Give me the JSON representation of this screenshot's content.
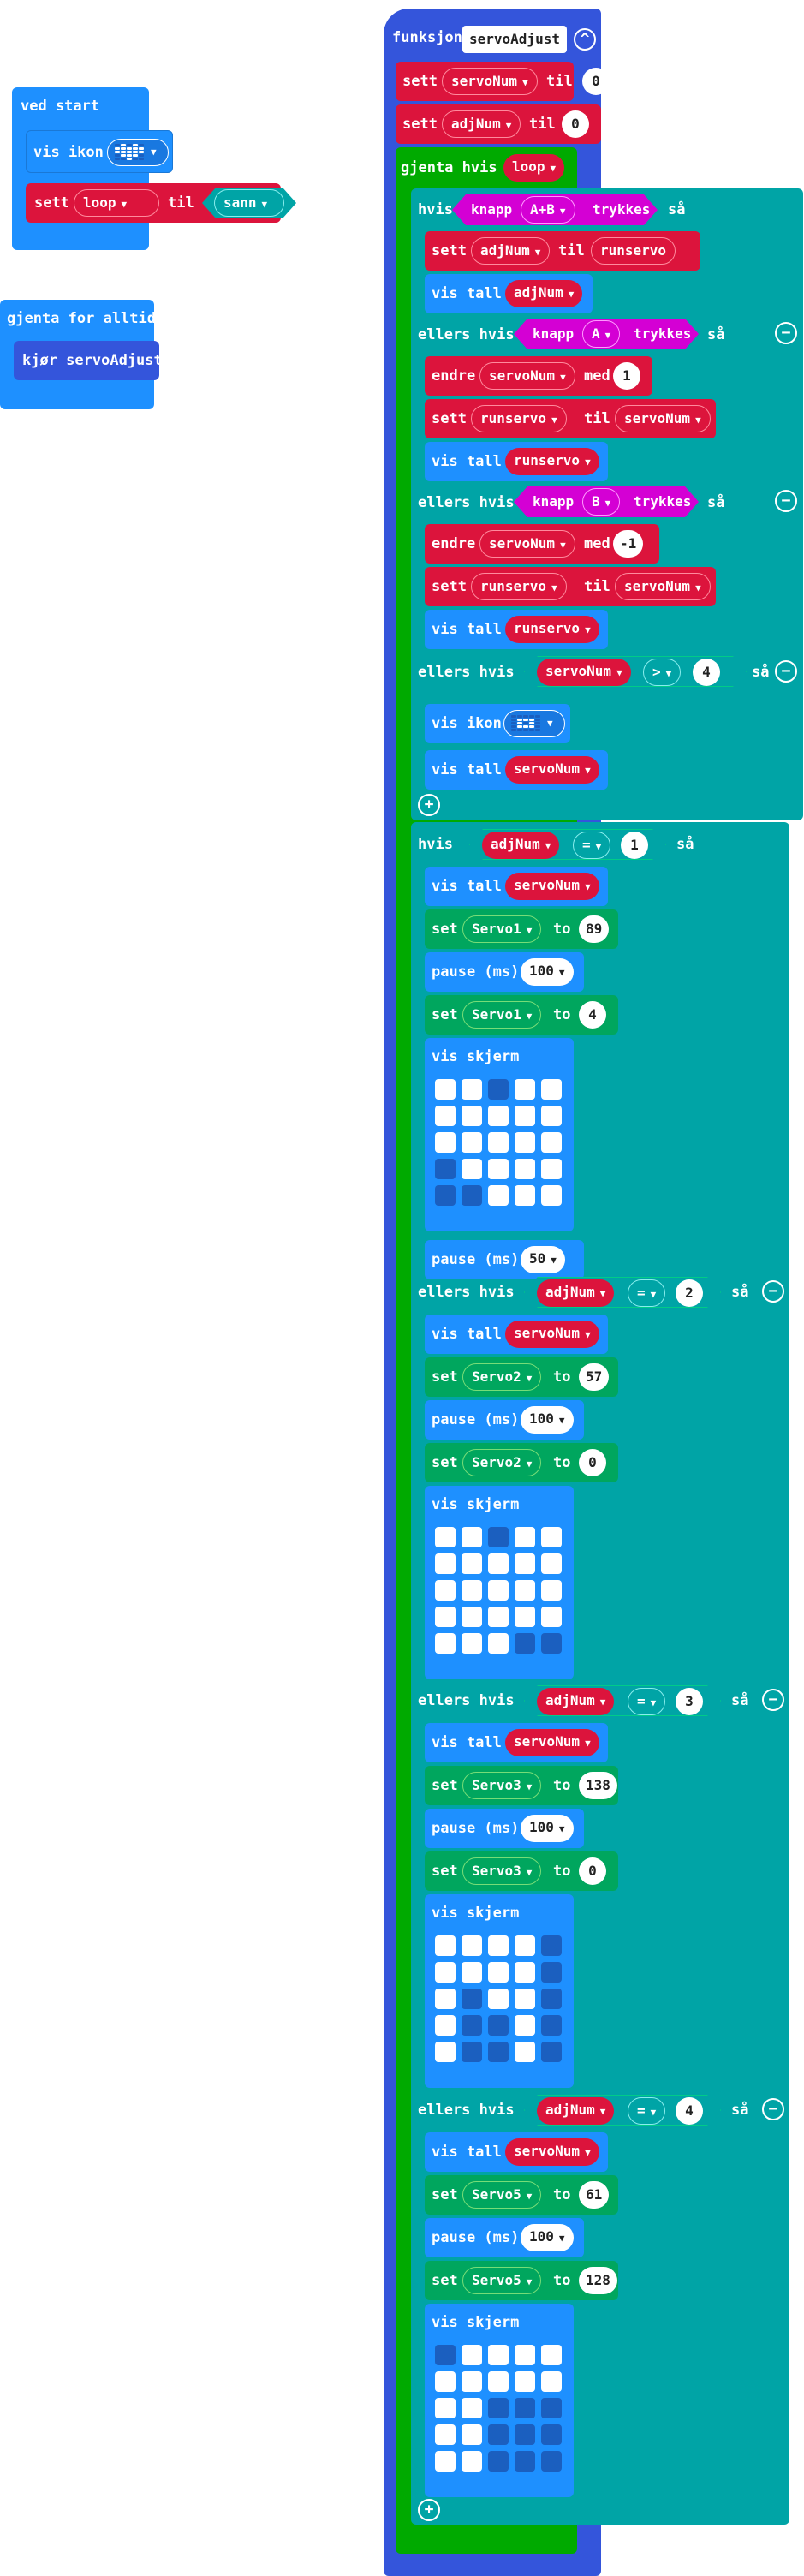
{
  "ved_start": {
    "title": "ved start",
    "vis_ikon": "vis ikon",
    "sett": "sett",
    "var": "loop",
    "til": "til",
    "value": "sann"
  },
  "forever": {
    "title": "gjenta for alltid",
    "call": "kjør servoAdjust"
  },
  "func": {
    "kw": "funksjon",
    "name": "servoAdjust",
    "collapse_icon": "chevron-up-icon",
    "sett1": {
      "kw": "sett",
      "var": "servoNum",
      "til": "til",
      "val": "0"
    },
    "sett2": {
      "kw": "sett",
      "var": "adjNum",
      "til": "til",
      "val": "0"
    },
    "while": {
      "kw": "gjenta hvis",
      "cond": "loop"
    },
    "btn": {
      "hvis": "hvis",
      "ellers_hvis": "ellers hvis",
      "saa": "så",
      "knapp": "knapp",
      "trykkes": "trykkes",
      "ab": "A+B",
      "a": "A",
      "b": "B",
      "sett_adj": {
        "kw": "sett",
        "var": "adjNum",
        "til": "til",
        "val": "runservo"
      },
      "vis_tall": "vis tall",
      "vis_ikon": "vis ikon",
      "endre": "endre",
      "med": "med",
      "plus1": "1",
      "minus1": "-1",
      "runservo": "runservo",
      "servoNum": "servoNum",
      "adjNum": "adjNum",
      "gt": ">",
      "four": "4"
    },
    "adj": {
      "hvis": "hvis",
      "ellers_hvis": "ellers hvis",
      "saa": "så",
      "eq": "=",
      "set": "set",
      "to": "to",
      "pause": "pause (ms)",
      "vis_skjerm": "vis skjerm",
      "vis_tall": "vis tall",
      "b1": {
        "n": "1",
        "servo": "Servo1",
        "v1": "89",
        "v2": "4",
        "p": "100",
        "p2": "50"
      },
      "b2": {
        "n": "2",
        "servo": "Servo2",
        "v1": "57",
        "v2": "0",
        "p": "100"
      },
      "b3": {
        "n": "3",
        "servo": "Servo3",
        "v1": "138",
        "v2": "0",
        "p": "100"
      },
      "b4": {
        "n": "4",
        "servo": "Servo5",
        "v1": "61",
        "v2": "128",
        "p": "100"
      }
    },
    "add_icon": "plus-circle-icon",
    "remove_icon": "minus-circle-icon"
  },
  "colors": {
    "functions": "#3455db",
    "basic": "#1e90ff",
    "variables": "#dc143c",
    "logic": "#00a4a6",
    "loops": "#00aa00",
    "input": "#d400d4",
    "servo": "#00a65e"
  }
}
